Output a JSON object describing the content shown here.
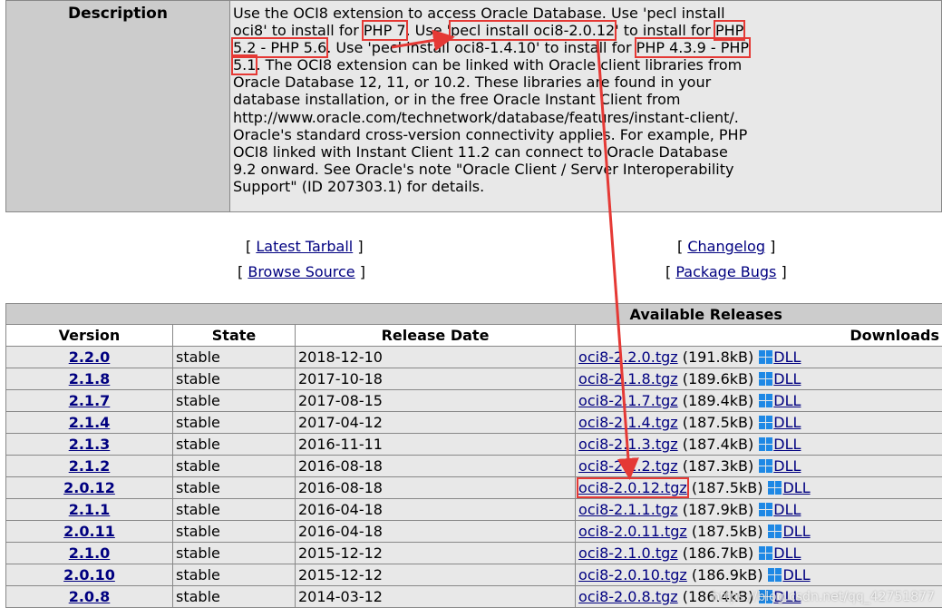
{
  "description": {
    "label": "Description",
    "before_php7": "Use the OCI8 extension to access Oracle Database. Use 'pecl install oci8' to install for ",
    "php7": "PHP 7",
    "mid1": ". Use '",
    "pecl_cmd": "pecl install oci8-2.0.12",
    "mid2": "' to install for ",
    "php52": "PHP 5.2 - PHP 5.6",
    "mid3": ". Use 'pecl install oci8-1.4.10' to install for ",
    "php43": "PHP 4.3.9 - PHP 5.1",
    "after": ". The OCI8 extension can be linked with Oracle client libraries from Oracle Database 12, 11, or 10.2. These libraries are found in your database installation, or in the free Oracle Instant Client from http://www.oracle.com/technetwork/database/features/instant-client/. Oracle's standard cross-version connectivity applies. For example, PHP OCI8 linked with Instant Client 11.2 can connect to Oracle Database 9.2 onward. See Oracle's note \"Oracle Client / Server Interoperability Support\" (ID 207303.1) for details."
  },
  "links": {
    "latest_tarball": "Latest Tarball",
    "browse_source": "Browse Source",
    "changelog": "Changelog",
    "package_bugs": "Package Bugs",
    "bracket_open": "[",
    "bracket_close": "]"
  },
  "releases": {
    "caption": "Available Releases",
    "columns": [
      "Version",
      "State",
      "Release Date",
      "Downloads"
    ],
    "dll_label": "DLL",
    "rows": [
      {
        "version": "2.2.0",
        "state": "stable",
        "date": "2018-12-10",
        "file": "oci8-2.2.0.tgz",
        "size": "(191.8kB)"
      },
      {
        "version": "2.1.8",
        "state": "stable",
        "date": "2017-10-18",
        "file": "oci8-2.1.8.tgz",
        "size": "(189.6kB)"
      },
      {
        "version": "2.1.7",
        "state": "stable",
        "date": "2017-08-15",
        "file": "oci8-2.1.7.tgz",
        "size": "(189.4kB)"
      },
      {
        "version": "2.1.4",
        "state": "stable",
        "date": "2017-04-12",
        "file": "oci8-2.1.4.tgz",
        "size": "(187.5kB)"
      },
      {
        "version": "2.1.3",
        "state": "stable",
        "date": "2016-11-11",
        "file": "oci8-2.1.3.tgz",
        "size": "(187.4kB)"
      },
      {
        "version": "2.1.2",
        "state": "stable",
        "date": "2016-08-18",
        "file": "oci8-2.1.2.tgz",
        "size": "(187.3kB)"
      },
      {
        "version": "2.0.12",
        "state": "stable",
        "date": "2016-08-18",
        "file": "oci8-2.0.12.tgz",
        "size": "(187.5kB)",
        "highlight": true
      },
      {
        "version": "2.1.1",
        "state": "stable",
        "date": "2016-04-18",
        "file": "oci8-2.1.1.tgz",
        "size": "(187.9kB)"
      },
      {
        "version": "2.0.11",
        "state": "stable",
        "date": "2016-04-18",
        "file": "oci8-2.0.11.tgz",
        "size": "(187.5kB)"
      },
      {
        "version": "2.1.0",
        "state": "stable",
        "date": "2015-12-12",
        "file": "oci8-2.1.0.tgz",
        "size": "(186.7kB)"
      },
      {
        "version": "2.0.10",
        "state": "stable",
        "date": "2015-12-12",
        "file": "oci8-2.0.10.tgz",
        "size": "(186.9kB)"
      },
      {
        "version": "2.0.8",
        "state": "stable",
        "date": "2014-03-12",
        "file": "oci8-2.0.8.tgz",
        "size": "(186.4kB)"
      }
    ]
  },
  "watermark": "https://blog.csdn.net/qq_42751877",
  "colors": {
    "highlight": "#e53935",
    "link": "#000080",
    "windows_icon": "#1e88e5"
  }
}
